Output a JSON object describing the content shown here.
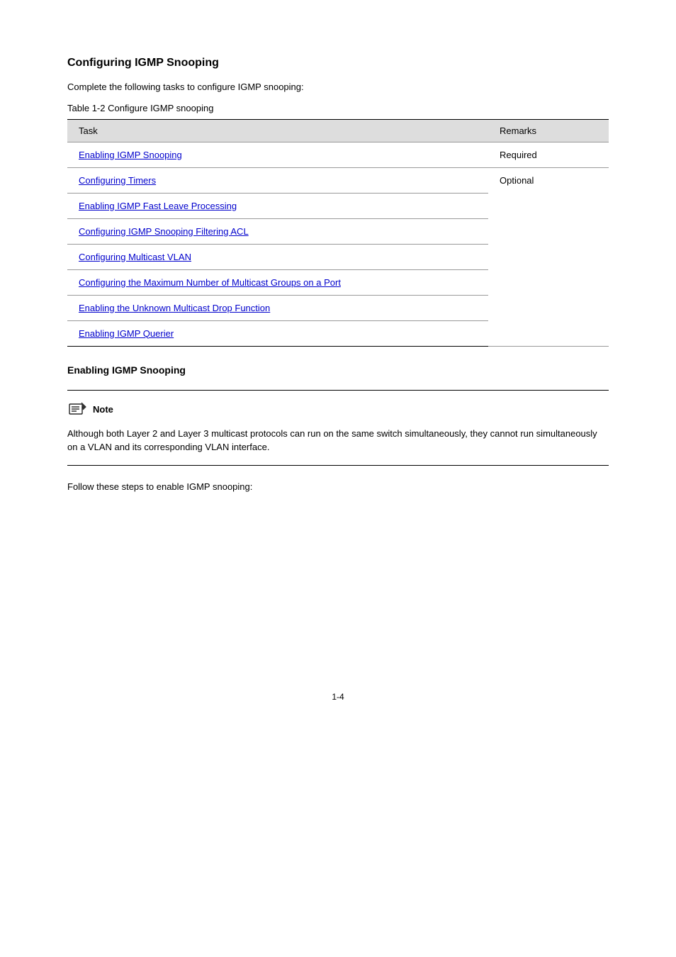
{
  "heading": "Configuring IGMP Snooping",
  "intro": "Complete the following tasks to configure IGMP snooping:",
  "table_label": "Table 1-2 Configure IGMP snooping",
  "table": {
    "headers": [
      "Task",
      "Remarks"
    ],
    "rows": [
      {
        "task_link": "Enabling IGMP Snooping",
        "task_rest": "",
        "remark": "Required"
      },
      {
        "task_link": "Configuring Timers",
        "task_rest": "",
        "remark": "Optional"
      },
      {
        "task_link": "Enabling IGMP Fast Leave Processing",
        "task_rest": "",
        "remark": "Optional"
      },
      {
        "task_link": "Configuring IGMP Snooping Filtering ACL",
        "task_rest": "",
        "remark": "Optional"
      },
      {
        "task_link": "Configuring Multicast VLAN",
        "task_rest": "",
        "remark": "Optional"
      },
      {
        "task_link": "Configuring the Maximum Number of Multicast Groups on a Port",
        "task_rest": "",
        "remark": "Optional"
      },
      {
        "task_link": "Enabling the Unknown Multicast Drop Function",
        "task_rest": "",
        "remark": "Optional"
      },
      {
        "task_link": "Enabling IGMP Querier",
        "task_rest": "",
        "remark": "Optional"
      }
    ]
  },
  "subsection": "Enabling IGMP Snooping",
  "note": {
    "label": "Note",
    "text": "Although both Layer 2 and Layer 3 multicast protocols can run on the same switch simultaneously, they cannot run simultaneously on a VLAN and its corresponding VLAN interface."
  },
  "post_note": "Follow these steps to enable IGMP snooping:",
  "page_number": "1-4"
}
